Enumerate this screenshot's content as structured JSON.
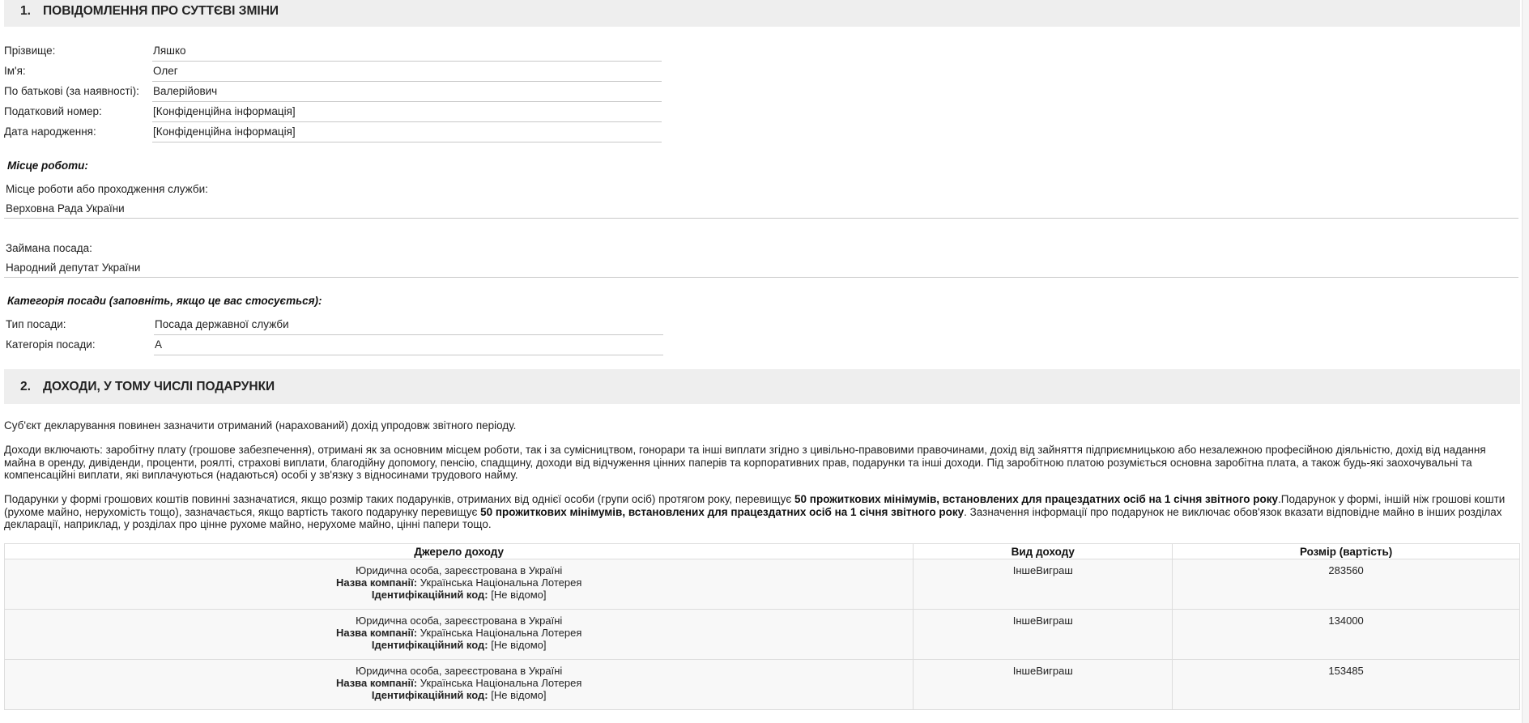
{
  "section1": {
    "number": "1.",
    "title": "ПОВІДОМЛЕННЯ ПРО СУТТЄВІ ЗМІНИ",
    "fields": [
      {
        "label": "Прізвище:",
        "value": "Ляшко"
      },
      {
        "label": "Ім'я:",
        "value": "Олег"
      },
      {
        "label": "По батькові (за наявності):",
        "value": "Валерійович"
      },
      {
        "label": "Податковий номер:",
        "value": "[Конфіденційна інформація]"
      },
      {
        "label": "Дата народження:",
        "value": "[Конфіденційна інформація]"
      }
    ],
    "workplace": {
      "heading": "Місце роботи:",
      "place_label": "Місце роботи або проходження служби:",
      "place_value": "Верховна Рада України",
      "position_label": "Займана посада:",
      "position_value": "Народний депутат України"
    },
    "category": {
      "heading": "Категорія посади (заповніть, якщо це вас стосується):",
      "type_label": "Тип посади:",
      "type_value": "Посада державної служби",
      "cat_label": "Категорія посади:",
      "cat_value": "А"
    }
  },
  "section2": {
    "number": "2.",
    "title": "ДОХОДИ, У ТОМУ ЧИСЛІ ПОДАРУНКИ",
    "intro": "Суб'єкт декларування повинен зазначити отриманий (нарахований) дохід упродовж звітного періоду.",
    "incomes_text": "Доходи включають: заробітну плату (грошове забезпечення), отримані як за основним місцем роботи, так і за сумісництвом, гонорари та інші виплати згідно з цивільно-правовими правочинами, дохід від зайняття підприємницькою або незалежною професійною діяльністю, дохід від надання майна в оренду, дивіденди, проценти, роялті, страхові виплати, благодійну допомогу, пенсію, спадщину, доходи від відчуження цінних паперів та корпоративних прав, подарунки та інші доходи. Під заробітною платою розуміється основна заробітна плата, а також будь-які заохочувальні та компенсаційні виплати, які виплачуються (надаються) особі у зв'язку з відносинами трудового найму.",
    "gifts_part1": "Подарунки у формі грошових коштів повинні зазначатися, якщо розмір таких подарунків, отриманих від однієї особи (групи осіб) протягом року, перевищує ",
    "gifts_bold1": "50 прожиткових мінімумів, встановлених для працездатних осіб на 1 січня звітного року",
    "gifts_part2": ".Подарунок у формі, іншій ніж грошові кошти (рухоме майно, нерухомість тощо), зазначається, якщо вартість такого подарунку перевищує ",
    "gifts_bold2": "50 прожиткових мінімумів, встановлених для працездатних осіб на 1 січня звітного року",
    "gifts_part3": ". Зазначення інформації про подарунок не виключає обов'язок вказати відповідне майно в інших розділах декларації, наприклад, у розділах про цінне рухоме майно, нерухоме майно, цінні папери тощо.",
    "table": {
      "headers": [
        "Джерело доходу",
        "Вид доходу",
        "Розмір (вартість)"
      ],
      "company_label": "Назва компанії:",
      "code_label": "Ідентифікаційний код:",
      "rows": [
        {
          "source_type": "Юридична особа, зареєстрована в Україні",
          "company": "Українська Національна Лотерея",
          "code": "[Не відомо]",
          "kind": "ІншеВиграш",
          "amount": "283560"
        },
        {
          "source_type": "Юридична особа, зареєстрована в Україні",
          "company": "Українська Національна Лотерея",
          "code": "[Не відомо]",
          "kind": "ІншеВиграш",
          "amount": "134000"
        },
        {
          "source_type": "Юридична особа, зареєстрована в Україні",
          "company": "Українська Національна Лотерея",
          "code": "[Не відомо]",
          "kind": "ІншеВиграш",
          "amount": "153485"
        }
      ]
    }
  }
}
